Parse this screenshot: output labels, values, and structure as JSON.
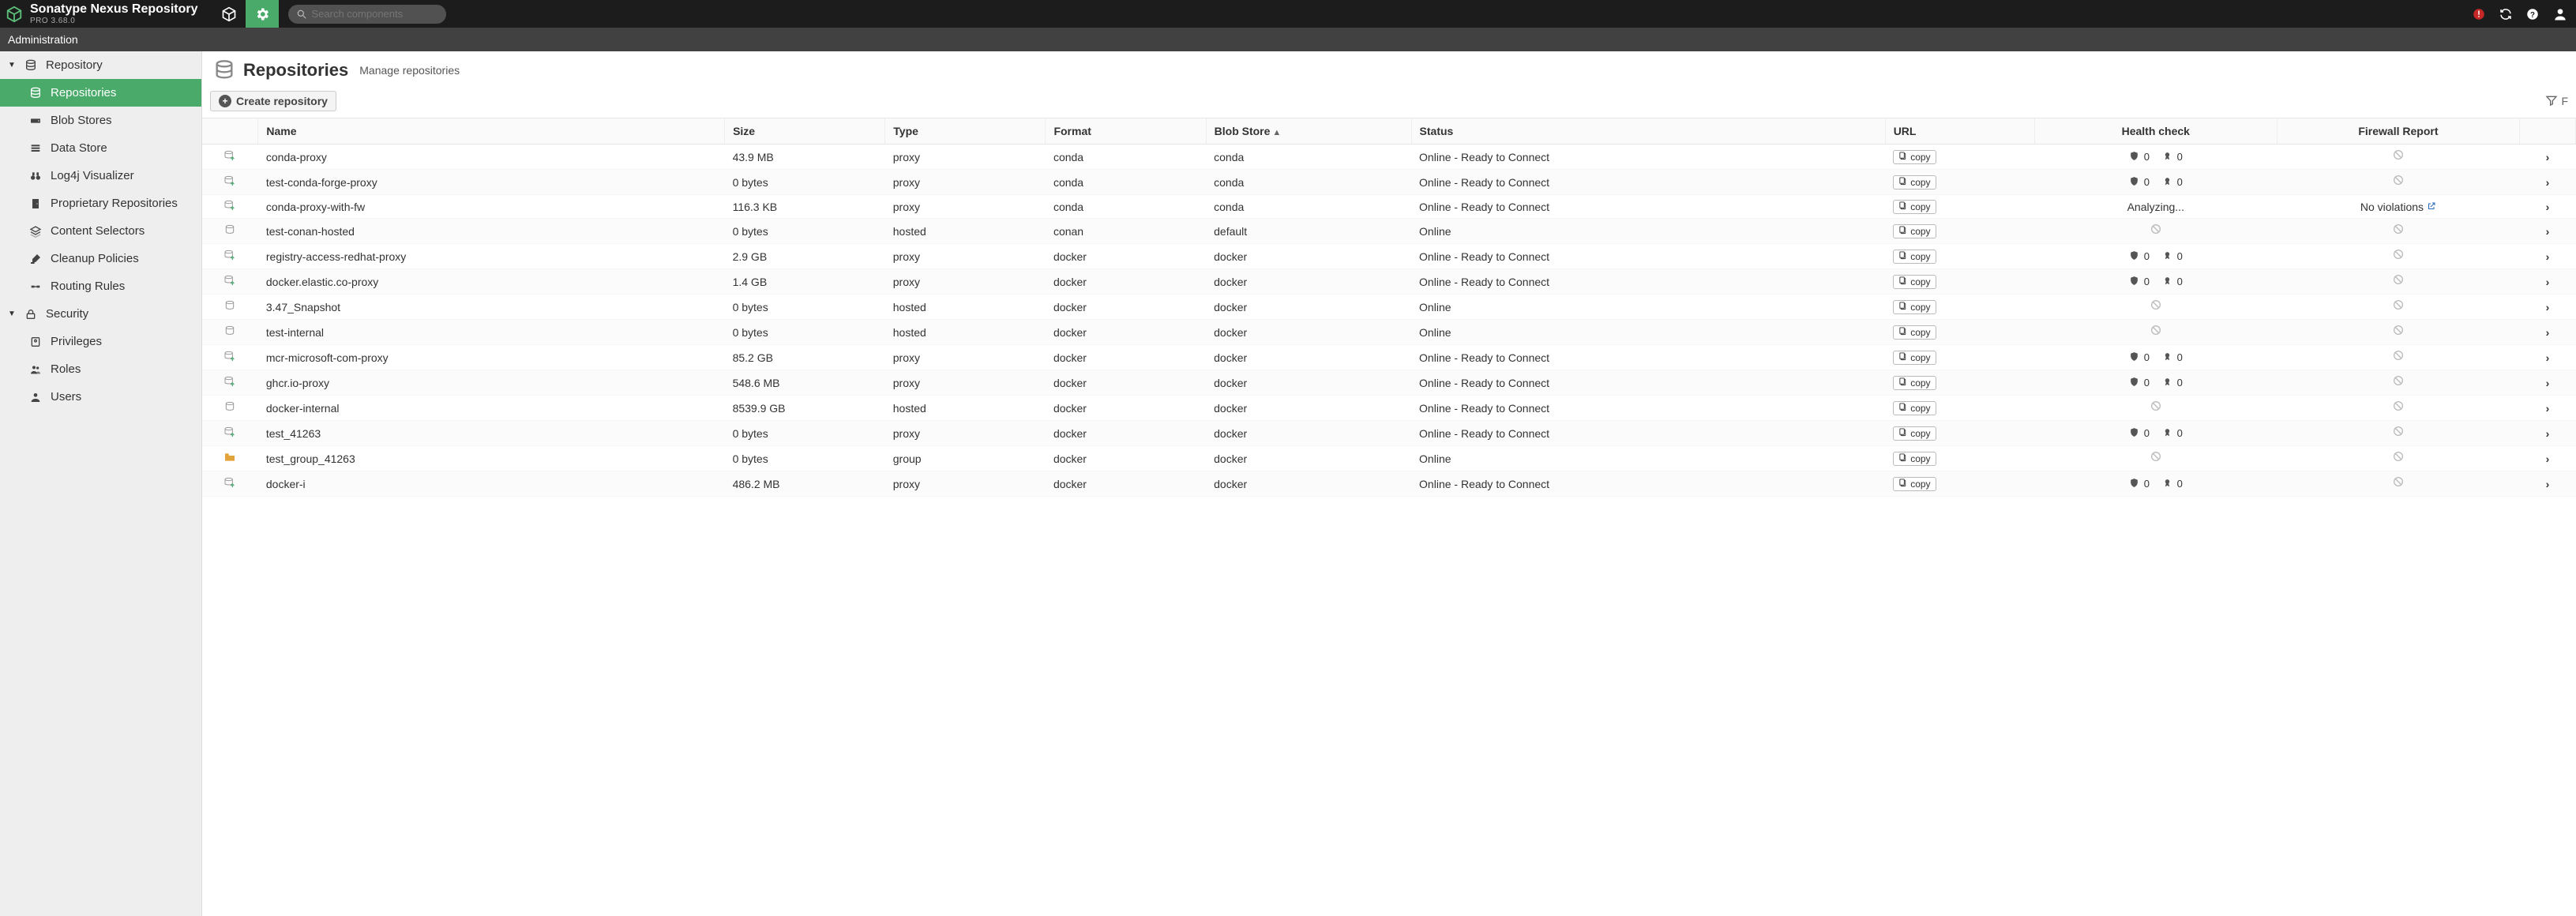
{
  "brand": {
    "title": "Sonatype Nexus Repository",
    "subtitle": "PRO 3.68.0"
  },
  "search": {
    "placeholder": "Search components"
  },
  "adminStrip": "Administration",
  "sidebar": {
    "repository": {
      "label": "Repository",
      "items": [
        {
          "label": "Repositories",
          "icon": "db",
          "active": true
        },
        {
          "label": "Blob Stores",
          "icon": "hdd"
        },
        {
          "label": "Data Store",
          "icon": "stack"
        },
        {
          "label": "Log4j Visualizer",
          "icon": "binoculars"
        },
        {
          "label": "Proprietary Repositories",
          "icon": "door"
        },
        {
          "label": "Content Selectors",
          "icon": "layers"
        },
        {
          "label": "Cleanup Policies",
          "icon": "brush"
        },
        {
          "label": "Routing Rules",
          "icon": "route"
        }
      ]
    },
    "security": {
      "label": "Security",
      "items": [
        {
          "label": "Privileges",
          "icon": "badge"
        },
        {
          "label": "Roles",
          "icon": "users"
        },
        {
          "label": "Users",
          "icon": "user"
        }
      ]
    }
  },
  "page": {
    "title": "Repositories",
    "desc": "Manage repositories"
  },
  "toolbar": {
    "create": "Create repository",
    "filterLetter": "F"
  },
  "columns": {
    "name": "Name",
    "size": "Size",
    "type": "Type",
    "format": "Format",
    "blob": "Blob Store",
    "status": "Status",
    "url": "URL",
    "health": "Health check",
    "firewall": "Firewall Report"
  },
  "copyLabel": "copy",
  "rows": [
    {
      "icon": "proxy",
      "name": "conda-proxy",
      "size": "43.9 MB",
      "type": "proxy",
      "format": "conda",
      "blob": "conda",
      "status": "Online - Ready to Connect",
      "health": {
        "kind": "counts",
        "shield": "0",
        "ribbon": "0"
      },
      "fw": {
        "kind": "ban"
      }
    },
    {
      "icon": "proxy",
      "name": "test-conda-forge-proxy",
      "size": "0 bytes",
      "type": "proxy",
      "format": "conda",
      "blob": "conda",
      "status": "Online - Ready to Connect",
      "health": {
        "kind": "counts",
        "shield": "0",
        "ribbon": "0"
      },
      "fw": {
        "kind": "ban"
      }
    },
    {
      "icon": "proxy",
      "name": "conda-proxy-with-fw",
      "size": "116.3 KB",
      "type": "proxy",
      "format": "conda",
      "blob": "conda",
      "status": "Online - Ready to Connect",
      "health": {
        "kind": "text",
        "text": "Analyzing..."
      },
      "fw": {
        "kind": "text",
        "text": "No violations",
        "ext": true
      }
    },
    {
      "icon": "hosted",
      "name": "test-conan-hosted",
      "size": "0 bytes",
      "type": "hosted",
      "format": "conan",
      "blob": "default",
      "status": "Online",
      "health": {
        "kind": "ban"
      },
      "fw": {
        "kind": "ban"
      }
    },
    {
      "icon": "proxy",
      "name": "registry-access-redhat-proxy",
      "size": "2.9 GB",
      "type": "proxy",
      "format": "docker",
      "blob": "docker",
      "status": "Online - Ready to Connect",
      "health": {
        "kind": "counts",
        "shield": "0",
        "ribbon": "0"
      },
      "fw": {
        "kind": "ban"
      }
    },
    {
      "icon": "proxy",
      "name": "docker.elastic.co-proxy",
      "size": "1.4 GB",
      "type": "proxy",
      "format": "docker",
      "blob": "docker",
      "status": "Online - Ready to Connect",
      "health": {
        "kind": "counts",
        "shield": "0",
        "ribbon": "0"
      },
      "fw": {
        "kind": "ban"
      }
    },
    {
      "icon": "hosted",
      "name": "3.47_Snapshot",
      "size": "0 bytes",
      "type": "hosted",
      "format": "docker",
      "blob": "docker",
      "status": "Online",
      "health": {
        "kind": "ban"
      },
      "fw": {
        "kind": "ban"
      }
    },
    {
      "icon": "hosted",
      "name": "test-internal",
      "size": "0 bytes",
      "type": "hosted",
      "format": "docker",
      "blob": "docker",
      "status": "Online",
      "health": {
        "kind": "ban"
      },
      "fw": {
        "kind": "ban"
      }
    },
    {
      "icon": "proxy",
      "name": "mcr-microsoft-com-proxy",
      "size": "85.2 GB",
      "type": "proxy",
      "format": "docker",
      "blob": "docker",
      "status": "Online - Ready to Connect",
      "health": {
        "kind": "counts",
        "shield": "0",
        "ribbon": "0"
      },
      "fw": {
        "kind": "ban"
      }
    },
    {
      "icon": "proxy",
      "name": "ghcr.io-proxy",
      "size": "548.6 MB",
      "type": "proxy",
      "format": "docker",
      "blob": "docker",
      "status": "Online - Ready to Connect",
      "health": {
        "kind": "counts",
        "shield": "0",
        "ribbon": "0"
      },
      "fw": {
        "kind": "ban"
      }
    },
    {
      "icon": "hosted",
      "name": "docker-internal",
      "size": "8539.9 GB",
      "type": "hosted",
      "format": "docker",
      "blob": "docker",
      "status": "Online - Ready to Connect",
      "health": {
        "kind": "ban"
      },
      "fw": {
        "kind": "ban"
      }
    },
    {
      "icon": "proxy",
      "name": "test_41263",
      "size": "0 bytes",
      "type": "proxy",
      "format": "docker",
      "blob": "docker",
      "status": "Online - Ready to Connect",
      "health": {
        "kind": "counts",
        "shield": "0",
        "ribbon": "0"
      },
      "fw": {
        "kind": "ban"
      }
    },
    {
      "icon": "group",
      "name": "test_group_41263",
      "size": "0 bytes",
      "type": "group",
      "format": "docker",
      "blob": "docker",
      "status": "Online",
      "health": {
        "kind": "ban"
      },
      "fw": {
        "kind": "ban"
      }
    },
    {
      "icon": "proxy",
      "name": "docker-i",
      "size": "486.2 MB",
      "type": "proxy",
      "format": "docker",
      "blob": "docker",
      "status": "Online - Ready to Connect",
      "health": {
        "kind": "counts",
        "shield": "0",
        "ribbon": "0"
      },
      "fw": {
        "kind": "ban"
      }
    }
  ]
}
